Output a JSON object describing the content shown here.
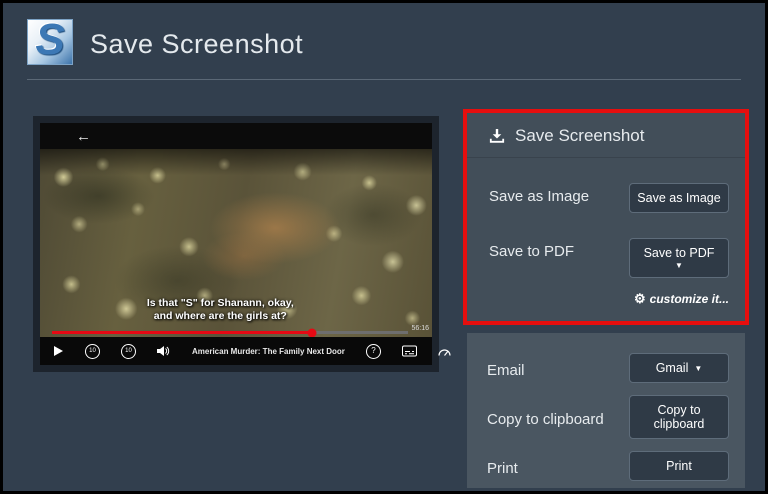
{
  "colors": {
    "page_background": "#323f4e",
    "panel_background": "#424e59",
    "highlight_red": "#e60e0e",
    "netflix_red": "#e50914",
    "logo_blue": "#3c78b5"
  },
  "header": {
    "logo_letter": "S",
    "title": "Save Screenshot"
  },
  "preview": {
    "player": {
      "back_arrow": "←",
      "subtitle_line1": "Is that \"S\" for Shanann, okay,",
      "subtitle_line2": "and where are the girls at?",
      "progress_percent": 73,
      "time_remaining": "56:16",
      "title": "American Murder: The Family Next Door",
      "skip_back_label": "10",
      "skip_forward_label": "10",
      "help_glyph": "?"
    }
  },
  "save_panel": {
    "title": "Save Screenshot",
    "rows": [
      {
        "label": "Save as Image",
        "button": "Save as Image"
      },
      {
        "label": "Save to PDF",
        "button": "Save to PDF"
      }
    ],
    "customize_label": "customize it...",
    "icons": {
      "gear": "⚙",
      "caret_down": "▼",
      "download": "download-icon"
    }
  },
  "actions_panel": {
    "rows": [
      {
        "label": "Email",
        "button": "Gmail"
      },
      {
        "label": "Copy to clipboard",
        "button": "Copy to clipboard"
      },
      {
        "label": "Print",
        "button": "Print"
      }
    ],
    "icons": {
      "caret_down": "▼"
    }
  }
}
